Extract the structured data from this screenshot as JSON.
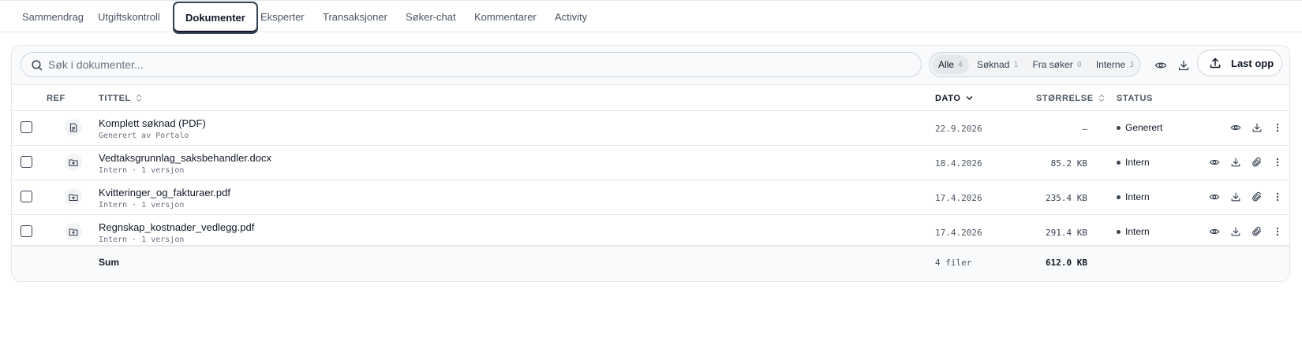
{
  "tabs": [
    {
      "label": "Sammendrag"
    },
    {
      "label": "Utgiftskontroll"
    },
    {
      "label": "Dokumenter",
      "active": true
    },
    {
      "label": "Eksperter"
    },
    {
      "label": "Transaksjoner"
    },
    {
      "label": "Søker-chat"
    },
    {
      "label": "Kommentarer"
    },
    {
      "label": "Activity"
    }
  ],
  "search": {
    "placeholder": "Søk i dokumenter...",
    "value": ""
  },
  "filters": [
    {
      "label": "Alle",
      "count": "4",
      "active": true
    },
    {
      "label": "Søknad",
      "count": "1"
    },
    {
      "label": "Fra søker",
      "count": "0"
    },
    {
      "label": "Interne",
      "count": "3"
    }
  ],
  "toolbar": {
    "preview_icon": "eye-icon",
    "download_icon": "download-icon",
    "upload_label": "Last opp",
    "upload_icon": "upload-icon"
  },
  "columns": {
    "ref": "REF",
    "title": "TITTEL",
    "date": "DATO",
    "size": "STØRRELSE",
    "status": "STATUS"
  },
  "rows": [
    {
      "title": "Komplett søknad (PDF)",
      "subtitle": "Generert av Portalo",
      "date": "22.9.2026",
      "size": "—",
      "status": "Generert",
      "icon": "document-icon",
      "attach": false
    },
    {
      "title": "Vedtaksgrunnlag_saksbehandler.docx",
      "subtitle": "Intern · 1 versjon",
      "date": "18.4.2026",
      "size": "85.2 KB",
      "status": "Intern",
      "icon": "folder-upload-icon",
      "attach": true
    },
    {
      "title": "Kvitteringer_og_fakturaer.pdf",
      "subtitle": "Intern · 1 versjon",
      "date": "17.4.2026",
      "size": "235.4 KB",
      "status": "Intern",
      "icon": "folder-upload-icon",
      "attach": true
    },
    {
      "title": "Regnskap_kostnader_vedlegg.pdf",
      "subtitle": "Intern · 1 versjon",
      "date": "17.4.2026",
      "size": "291.4 KB",
      "status": "Intern",
      "icon": "folder-upload-icon",
      "attach": true
    }
  ],
  "summary": {
    "label": "Sum",
    "files": "4 filer",
    "total": "612.0 KB"
  },
  "colors": {
    "accent": "#334155",
    "border": "#e5e7eb",
    "muted": "#6b7280"
  }
}
